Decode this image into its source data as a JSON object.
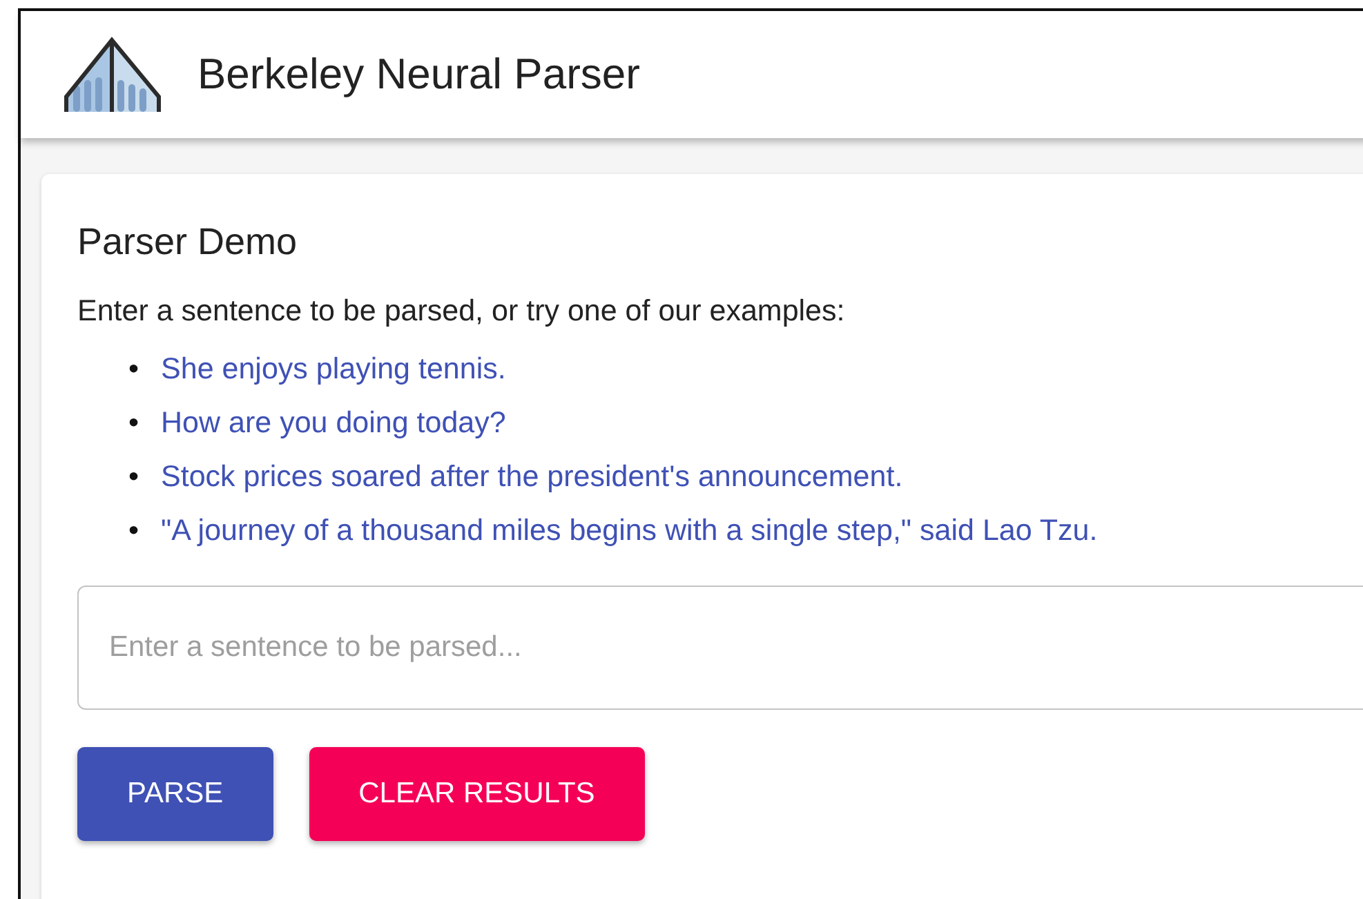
{
  "header": {
    "title": "Berkeley Neural Parser"
  },
  "card": {
    "heading": "Parser Demo",
    "intro": "Enter a sentence to be parsed, or try one of our examples:",
    "examples": [
      {
        "bullet": "•",
        "text": "She enjoys playing tennis."
      },
      {
        "bullet": "•",
        "text": "How are you doing today?"
      },
      {
        "bullet": "•",
        "text": "Stock prices soared after the president's announcement."
      },
      {
        "bullet": "•",
        "text": "\"A journey of a thousand miles begins with a single step,\" said Lao Tzu."
      }
    ],
    "input": {
      "placeholder": "Enter a sentence to be parsed..."
    },
    "buttons": [
      {
        "label": "PARSE",
        "kind": "primary"
      },
      {
        "label": "CLEAR RESULTS",
        "kind": "secondary"
      }
    ]
  }
}
